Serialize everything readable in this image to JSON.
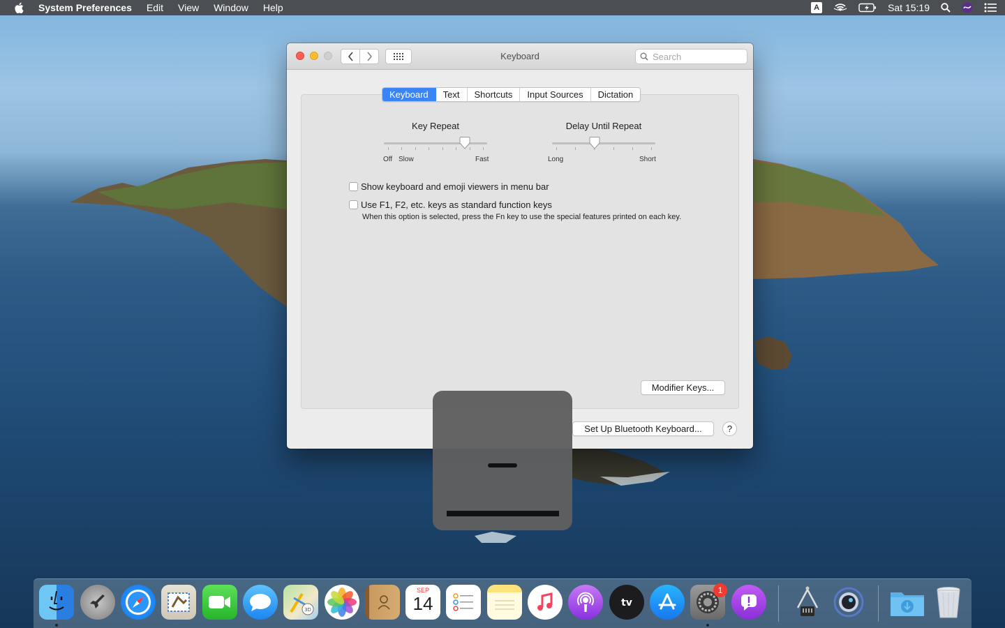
{
  "menubar": {
    "app_name": "System Preferences",
    "items": [
      "Edit",
      "View",
      "Window",
      "Help"
    ],
    "input_source": "A",
    "clock": "Sat 15:19"
  },
  "window": {
    "title": "Keyboard",
    "search_placeholder": "Search",
    "tabs": [
      {
        "label": "Keyboard",
        "active": true
      },
      {
        "label": "Text",
        "active": false
      },
      {
        "label": "Shortcuts",
        "active": false
      },
      {
        "label": "Input Sources",
        "active": false
      },
      {
        "label": "Dictation",
        "active": false
      }
    ],
    "key_repeat": {
      "title": "Key Repeat",
      "label_off": "Off",
      "label_slow": "Slow",
      "label_fast": "Fast",
      "value_fraction": 0.82
    },
    "delay_until_repeat": {
      "title": "Delay Until Repeat",
      "label_long": "Long",
      "label_short": "Short",
      "value_fraction": 0.4
    },
    "options": [
      {
        "label": "Show keyboard and emoji viewers in menu bar",
        "checked": false
      },
      {
        "label": "Use F1, F2, etc. keys as standard function keys",
        "checked": false
      }
    ],
    "fn_note": "When this option is selected, press the Fn key to use the special features printed on each key.",
    "modifier_keys_button": "Modifier Keys...",
    "bluetooth_button": "Set Up Bluetooth Keyboard...",
    "help_button": "?"
  },
  "dock": {
    "calendar_month": "SEP",
    "calendar_day": "14",
    "system_prefs_badge": "1",
    "apps": [
      "finder-icon",
      "launchpad-icon",
      "safari-icon",
      "mail-icon",
      "facetime-icon",
      "messages-icon",
      "maps-icon",
      "photos-icon",
      "contacts-icon",
      "calendar-icon",
      "reminders-icon",
      "notes-icon",
      "music-icon",
      "podcasts-icon",
      "tv-icon",
      "app-store-icon",
      "system-preferences-icon",
      "feedback-assistant-icon",
      "usb-tool-icon",
      "screen-recorder-icon",
      "downloads-folder-icon",
      "trash-icon"
    ]
  }
}
